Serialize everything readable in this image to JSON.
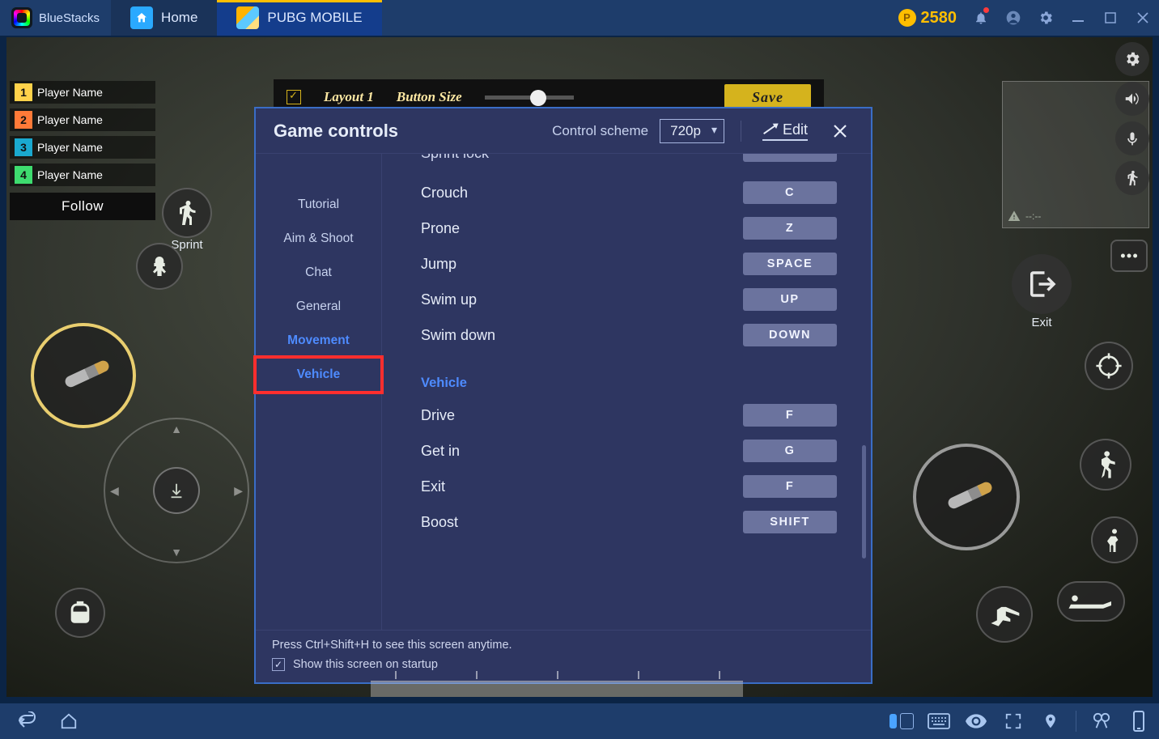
{
  "topbar": {
    "brand": "BlueStacks",
    "tabs": [
      {
        "label": "Home"
      },
      {
        "label": "PUBG MOBILE"
      }
    ],
    "coins": "2580"
  },
  "game": {
    "players": [
      {
        "rank": "1",
        "name": "Player Name"
      },
      {
        "rank": "2",
        "name": "Player Name"
      },
      {
        "rank": "3",
        "name": "Player Name"
      },
      {
        "rank": "4",
        "name": "Player Name"
      }
    ],
    "follow": "Follow",
    "sprint": "Sprint",
    "exit": "Exit",
    "minimap_time": "--:--"
  },
  "save_bar": {
    "layout": "Layout 1",
    "btn_size": "Button Size",
    "save": "Save"
  },
  "modal": {
    "title": "Game controls",
    "scheme_label": "Control scheme",
    "scheme_value": "720p",
    "edit": "Edit",
    "sidebar": [
      {
        "label": "Tutorial"
      },
      {
        "label": "Aim & Shoot"
      },
      {
        "label": "Chat"
      },
      {
        "label": "General"
      },
      {
        "label": "Movement"
      },
      {
        "label": "Vehicle"
      }
    ],
    "partial_label": "Sprint lock",
    "rows_a": [
      {
        "label": "Crouch",
        "key": "C"
      },
      {
        "label": "Prone",
        "key": "Z"
      },
      {
        "label": "Jump",
        "key": "SPACE"
      },
      {
        "label": "Swim up",
        "key": "UP"
      },
      {
        "label": "Swim down",
        "key": "DOWN"
      }
    ],
    "section_vehicle": "Vehicle",
    "rows_b": [
      {
        "label": "Drive",
        "key": "F"
      },
      {
        "label": "Get in",
        "key": "G"
      },
      {
        "label": "Exit",
        "key": "F"
      },
      {
        "label": "Boost",
        "key": "SHIFT"
      }
    ],
    "footer_hint": "Press Ctrl+Shift+H to see this screen anytime.",
    "footer_check": "Show this screen on startup"
  }
}
